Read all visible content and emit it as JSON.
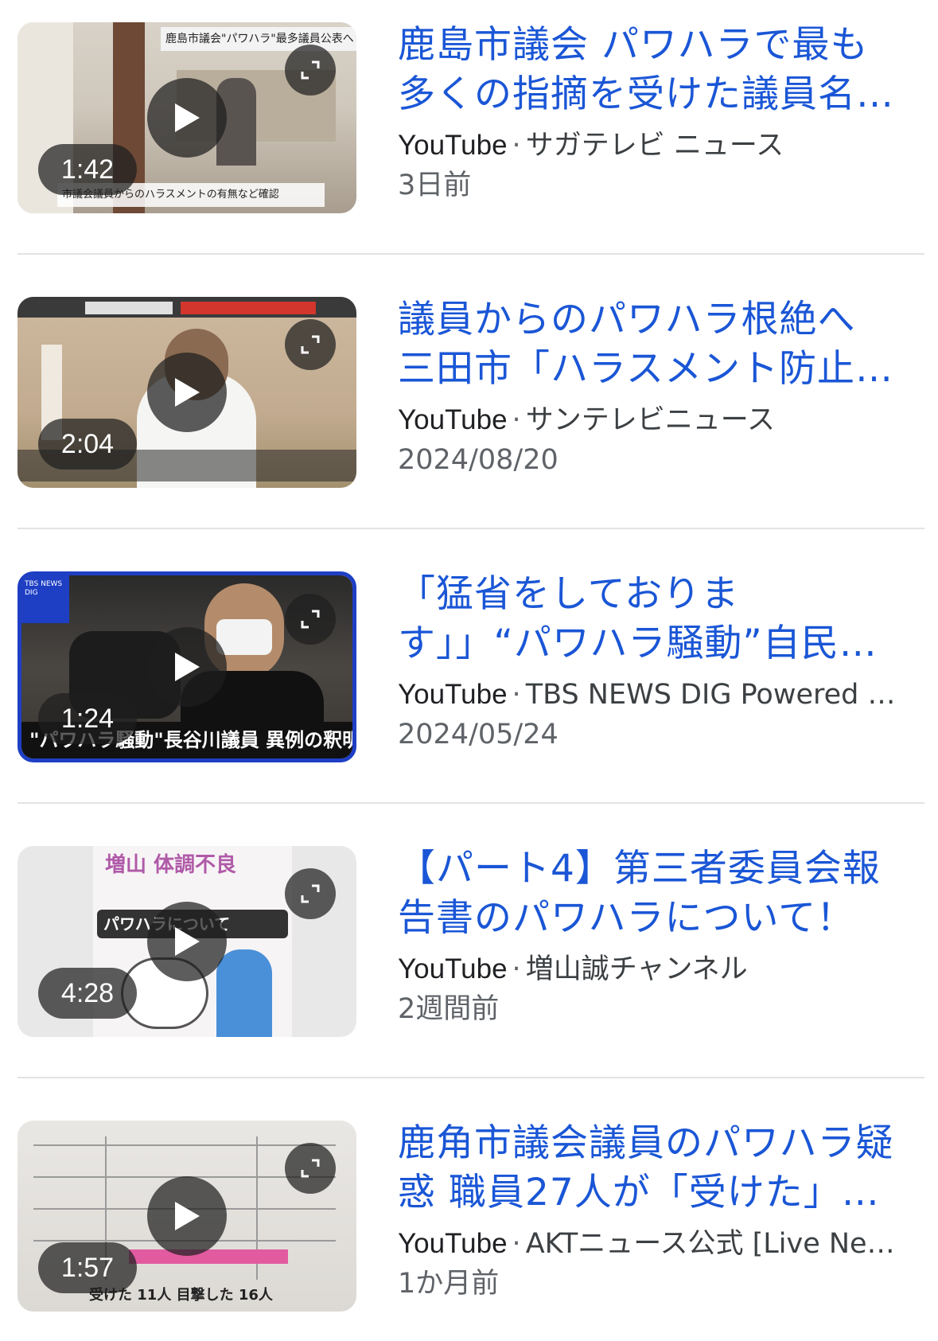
{
  "videos": [
    {
      "title_line1": "鹿島市議会 パワハラで最も",
      "title_line2": "多くの指摘を受けた議員名…",
      "site": "YouTube",
      "channel": "サガテレビ ニュース",
      "date": "3日前",
      "duration": "1:42",
      "thumb_caption_top": "鹿島市議会\"パワハラ\"最多議員公表へ",
      "thumb_caption_bottom": "市議会議員からのハラスメントの有無など確認"
    },
    {
      "title_line1": "議員からのパワハラ根絶へ",
      "title_line2": "三田市「ハラスメント防止…",
      "site": "YouTube",
      "channel": "サンテレビニュース",
      "date": "2024/08/20",
      "duration": "2:04",
      "thumb_caption_top": "",
      "thumb_caption_bottom": ""
    },
    {
      "title_line1": "「猛省をしておりま",
      "title_line2": "す」」“パワハラ騒動”自民…",
      "site": "YouTube",
      "channel": "TBS NEWS DIG Powered …",
      "date": "2024/05/24",
      "duration": "1:24",
      "thumb_caption_top": "TBS NEWS DIG",
      "thumb_caption_bottom": "\"パワハラ騒動\"長谷川議員 異例の釈明"
    },
    {
      "title_line1": "【パート4】第三者委員会報",
      "title_line2": "告書のパワハラについて！",
      "site": "YouTube",
      "channel": "増山誠チャンネル",
      "date": "2週間前",
      "duration": "4:28",
      "thumb_caption_top": "増山 体調不良",
      "thumb_caption_bottom": "パワハラについて"
    },
    {
      "title_line1": "鹿角市議会議員のパワハラ疑",
      "title_line2": "惑 職員27人が「受けた」…",
      "site": "YouTube",
      "channel": "AKTニュース公式 [Live Ne…",
      "date": "1か月前",
      "duration": "1:57",
      "thumb_caption_top": "",
      "thumb_caption_bottom": "受けた 11人 目撃した 16人"
    }
  ],
  "separator": "·",
  "colors": {
    "title": "#1a56d6",
    "meta": "#5f6368",
    "divider": "#e3e3e3"
  }
}
